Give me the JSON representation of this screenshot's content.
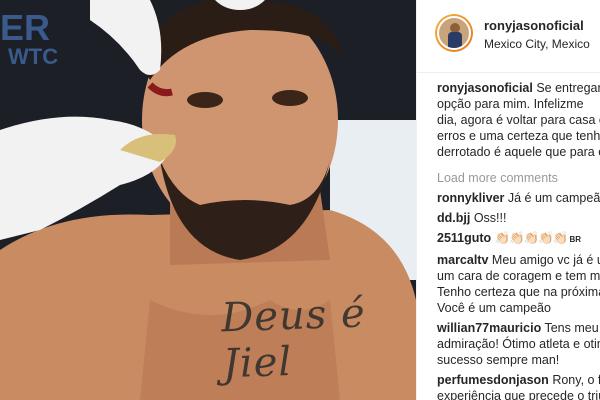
{
  "photo": {
    "poster_line1": "ER",
    "poster_line2": "WTC",
    "tattoo_text": "Deus é Jiel"
  },
  "post": {
    "username": "ronyjasonoficial",
    "location": "Mexico City, Mexico",
    "caption_lines": [
      "Se entregar n",
      "opção para mim. Infelizme",
      "dia, agora é voltar para casa e",
      "erros e uma certeza que tenho",
      "derrotado é aquele que para c"
    ],
    "load_more": "Load more comments",
    "comments": [
      {
        "user": "ronnykliver",
        "lines": [
          "Já é um campeão"
        ]
      },
      {
        "user": "dd.bjj",
        "lines": [
          "Oss!!!"
        ]
      },
      {
        "user": "2511guto",
        "lines": [
          "👏🏻👏🏻👏🏻👏🏻👏🏻"
        ],
        "suffix": "BR"
      },
      {
        "user": "marcaltv",
        "lines": [
          "Meu amigo vc já é u",
          "um cara de coragem e tem me",
          "Tenho certeza que na próxima",
          "Você é um campeão"
        ]
      },
      {
        "user": "willian77mauricio",
        "lines": [
          "Tens meu re",
          "admiração! Ótimo atleta e otim",
          "sucesso sempre man!"
        ]
      },
      {
        "user": "perfumesdonjason",
        "lines": [
          "Rony, o fra",
          "experiência que precede o triu"
        ]
      }
    ]
  }
}
